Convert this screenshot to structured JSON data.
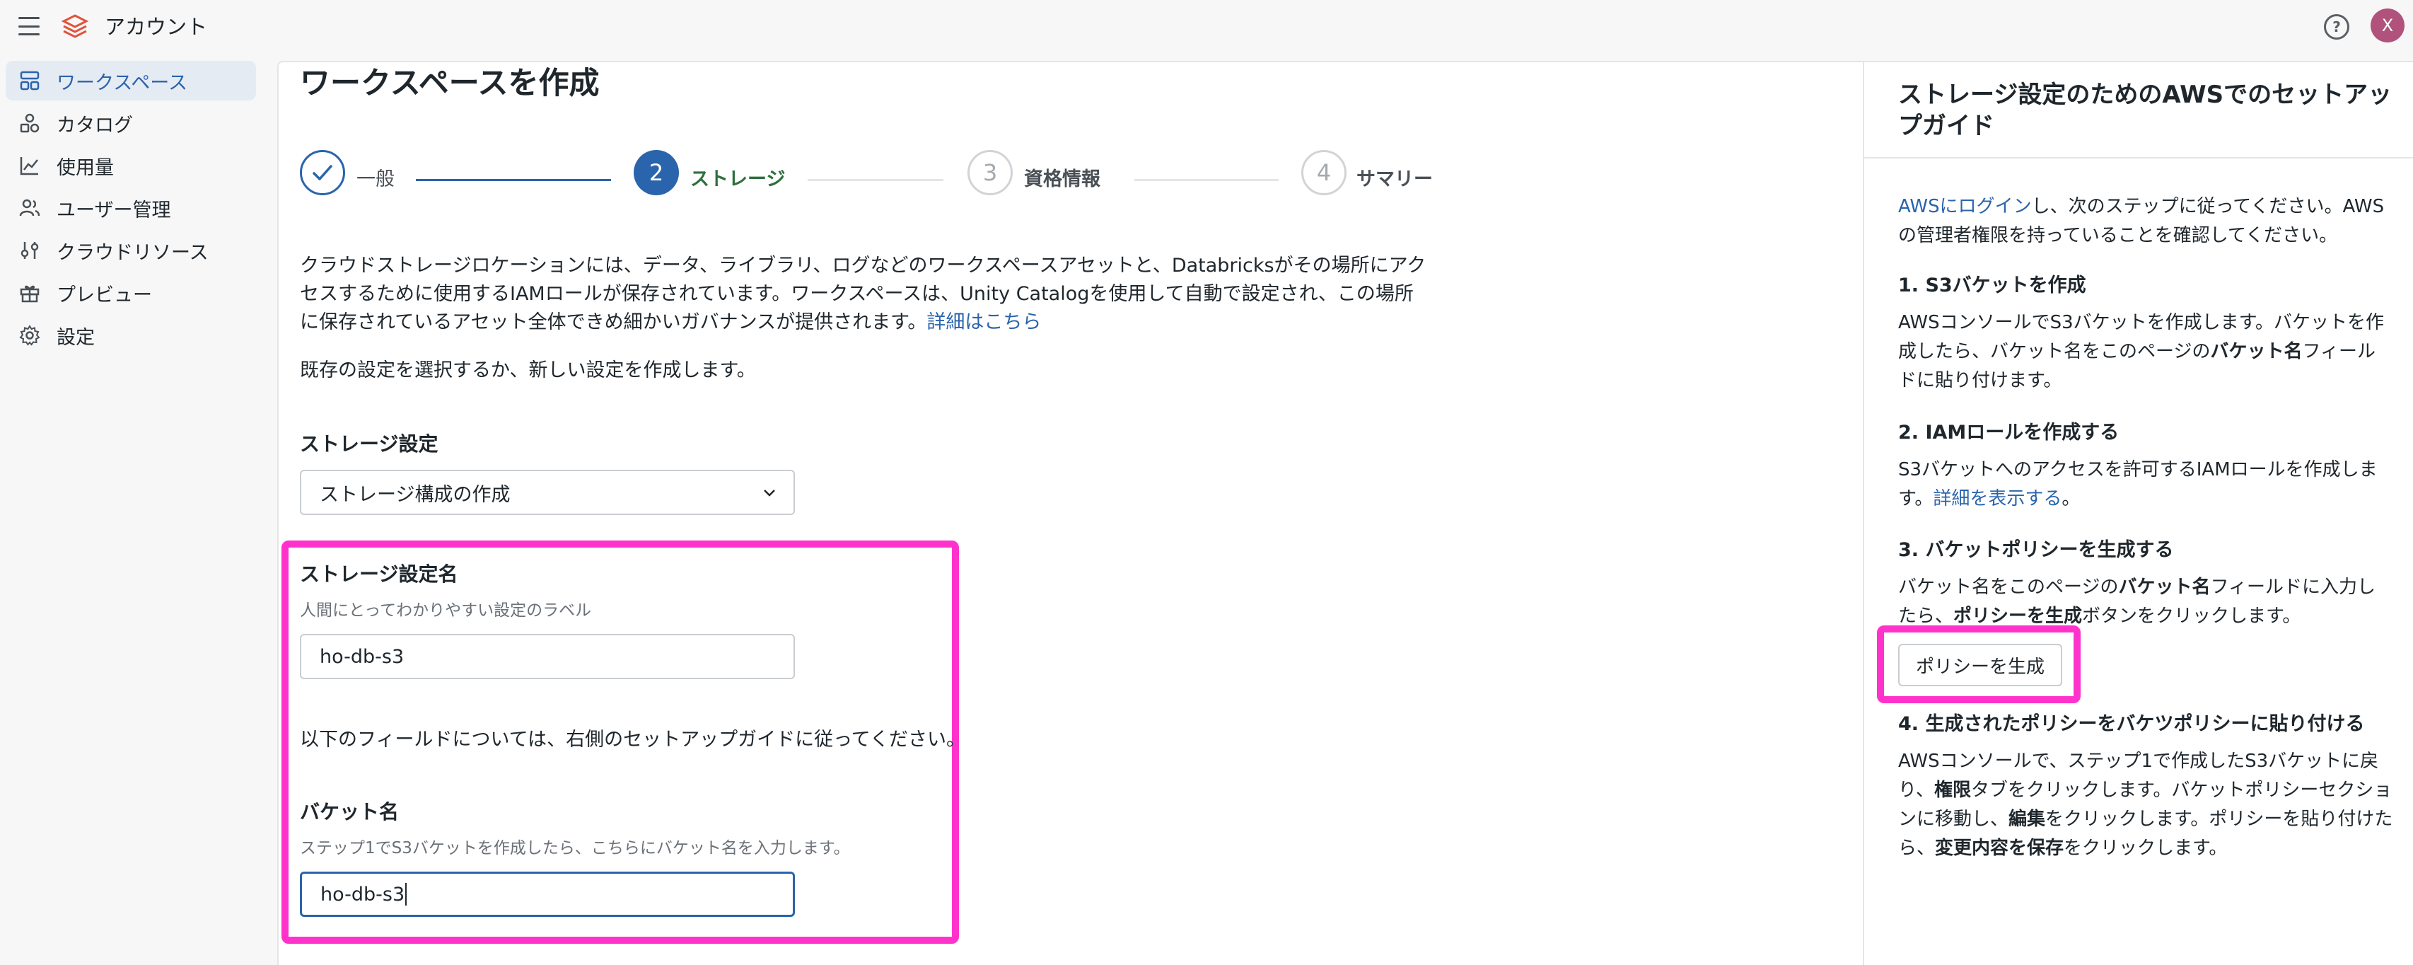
{
  "app": {
    "title": "アカウント",
    "avatar_initial": "X"
  },
  "sidebar": {
    "items": [
      {
        "label": "ワークスペース",
        "icon": "workspace-icon",
        "active": true
      },
      {
        "label": "カタログ",
        "icon": "catalog-icon"
      },
      {
        "label": "使用量",
        "icon": "chart-line-icon"
      },
      {
        "label": "ユーザー管理",
        "icon": "users-icon"
      },
      {
        "label": "クラウドリソース",
        "icon": "sliders-icon"
      },
      {
        "label": "プレビュー",
        "icon": "gift-icon"
      },
      {
        "label": "設定",
        "icon": "gear-icon"
      }
    ]
  },
  "page": {
    "title": "ワークスペースを作成",
    "steps": [
      {
        "num": "✓",
        "label": "一般",
        "state": "done"
      },
      {
        "num": "2",
        "label": "ストレージ",
        "state": "current"
      },
      {
        "num": "3",
        "label": "資格情報",
        "state": "todo"
      },
      {
        "num": "4",
        "label": "サマリー",
        "state": "todo"
      }
    ],
    "description": "クラウドストレージロケーションには、データ、ライブラリ、ログなどのワークスペースアセットと、Databricksがその場所にアクセスするために使用するIAMロールが保存されています。ワークスペースは、Unity Catalogを使用して自動で設定され、この場所に保存されているアセット全体できめ細かいガバナンスが提供されます。",
    "learn_more": "詳細はこちら",
    "subdescription": "既存の設定を選択するか、新しい設定を作成します。",
    "storage_config_label": "ストレージ設定",
    "storage_config_value": "ストレージ構成の作成",
    "config_name_label": "ストレージ設定名",
    "config_name_hint": "人間にとってわかりやすい設定のラベル",
    "config_name_value": "ho-db-s3",
    "guide_note": "以下のフィールドについては、右側のセットアップガイドに従ってください。",
    "bucket_label": "バケット名",
    "bucket_hint": "ステップ1でS3バケットを作成したら、こちらにバケット名を入力します。",
    "bucket_value": "ho-db-s3"
  },
  "guide": {
    "title": "ストレージ設定のためのAWSでのセットアップガイド",
    "intro_link": "AWSにログイン",
    "intro_rest": "し、次のステップに従ってください。AWSの管理者権限を持っていることを確認してください。",
    "step1_head": "1. S3バケットを作成",
    "step1_a": "AWSコンソールでS3バケットを作成します。バケットを作成したら、バケット名をこのページの",
    "step1_b": "バケット名",
    "step1_c": "フィールドに貼り付けます。",
    "step2_head": "2. IAMロールを作成する",
    "step2_a": "S3バケットへのアクセスを許可するIAMロールを作成します。",
    "step2_link": "詳細を表示する",
    "step2_c": "。",
    "step3_head": "3. バケットポリシーを生成する",
    "step3_a": "バケット名をこのページの",
    "step3_b": "バケット名",
    "step3_c": "フィールドに入力したら、",
    "step3_d": "ポリシーを生成",
    "step3_e": "ボタンをクリックします。",
    "generate_button": "ポリシーを生成",
    "step4_head": "4. 生成されたポリシーをバケツポリシーに貼り付ける",
    "step4_a": "AWSコンソールで、ステップ1で作成したS3バケットに戻り、",
    "step4_b": "権限",
    "step4_c": "タブをクリックします。バケットポリシーセクションに移動し、",
    "step4_d": "編集",
    "step4_e": "をクリックします。ポリシーを貼り付けたら、",
    "step4_f": "変更内容を保存",
    "step4_g": "をクリックします。"
  },
  "colors": {
    "accent": "#2a64ac",
    "highlight": "#ff33cc",
    "avatar": "#b0527c"
  }
}
